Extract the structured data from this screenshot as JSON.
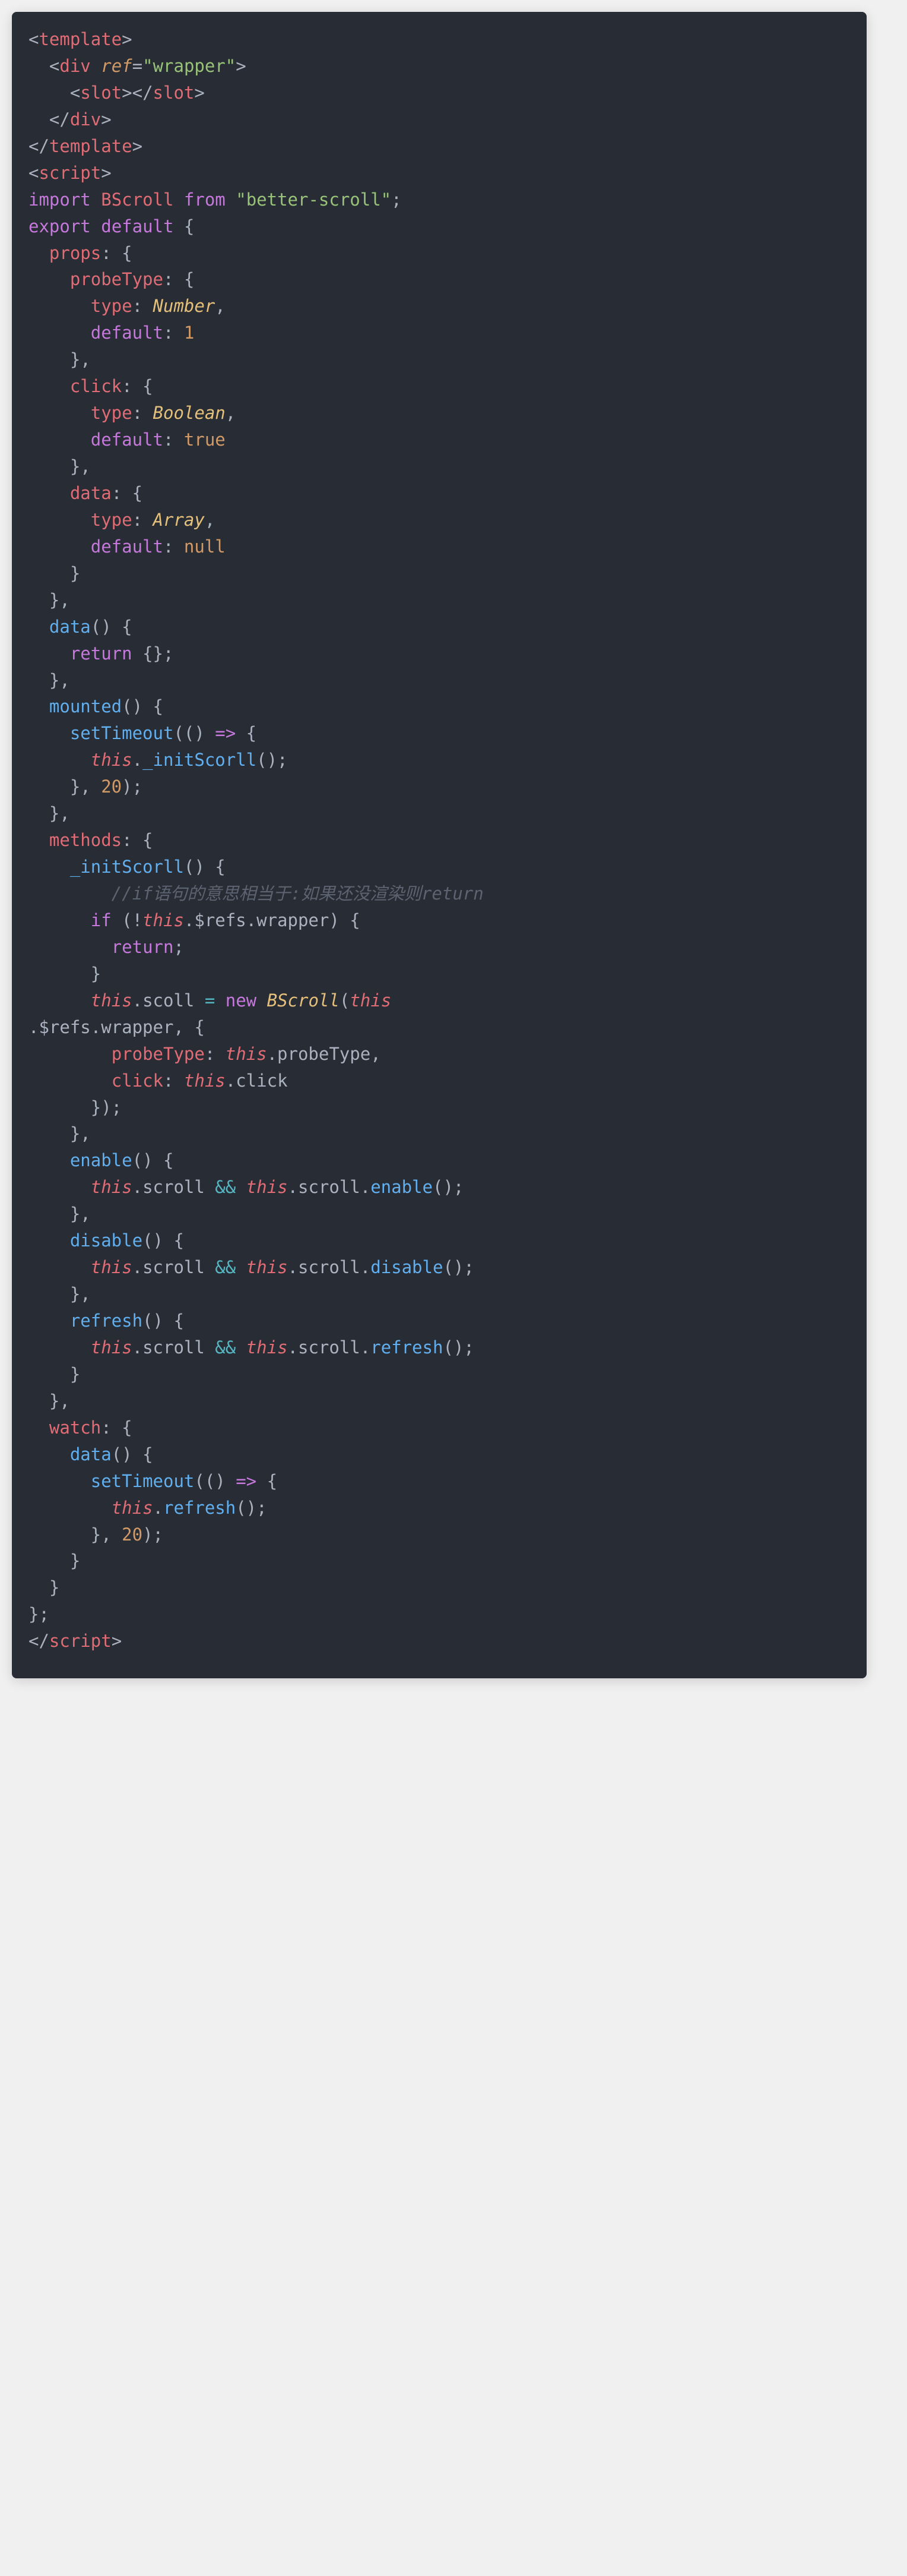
{
  "lines": [
    [
      {
        "c": "p",
        "t": "<"
      },
      {
        "c": "r",
        "t": "template"
      },
      {
        "c": "p",
        "t": ">"
      }
    ],
    [
      {
        "c": "p",
        "t": "  <"
      },
      {
        "c": "r",
        "t": "div"
      },
      {
        "c": "p",
        "t": " "
      },
      {
        "c": "o i",
        "t": "ref"
      },
      {
        "c": "p",
        "t": "="
      },
      {
        "c": "g",
        "t": "\"wrapper\""
      },
      {
        "c": "p",
        "t": ">"
      }
    ],
    [
      {
        "c": "p",
        "t": "    <"
      },
      {
        "c": "r",
        "t": "slot"
      },
      {
        "c": "p",
        "t": "></"
      },
      {
        "c": "r",
        "t": "slot"
      },
      {
        "c": "p",
        "t": ">"
      }
    ],
    [
      {
        "c": "p",
        "t": "  </"
      },
      {
        "c": "r",
        "t": "div"
      },
      {
        "c": "p",
        "t": ">"
      }
    ],
    [
      {
        "c": "p",
        "t": "</"
      },
      {
        "c": "r",
        "t": "template"
      },
      {
        "c": "p",
        "t": ">"
      }
    ],
    [
      {
        "c": "p",
        "t": "<"
      },
      {
        "c": "r",
        "t": "script"
      },
      {
        "c": "p",
        "t": ">"
      }
    ],
    [
      {
        "c": "pu",
        "t": "import"
      },
      {
        "c": "p",
        "t": " "
      },
      {
        "c": "r",
        "t": "BScroll"
      },
      {
        "c": "p",
        "t": " "
      },
      {
        "c": "pu",
        "t": "from"
      },
      {
        "c": "p",
        "t": " "
      },
      {
        "c": "g",
        "t": "\"better-scroll\""
      },
      {
        "c": "p",
        "t": ";"
      }
    ],
    [
      {
        "c": "pu",
        "t": "export"
      },
      {
        "c": "p",
        "t": " "
      },
      {
        "c": "pu",
        "t": "default"
      },
      {
        "c": "p",
        "t": " {"
      }
    ],
    [
      {
        "c": "p",
        "t": "  "
      },
      {
        "c": "r",
        "t": "props"
      },
      {
        "c": "p",
        "t": ": {"
      }
    ],
    [
      {
        "c": "p",
        "t": "    "
      },
      {
        "c": "r",
        "t": "probeType"
      },
      {
        "c": "p",
        "t": ": {"
      }
    ],
    [
      {
        "c": "p",
        "t": "      "
      },
      {
        "c": "r",
        "t": "type"
      },
      {
        "c": "p",
        "t": ": "
      },
      {
        "c": "y i",
        "t": "Number"
      },
      {
        "c": "p",
        "t": ","
      }
    ],
    [
      {
        "c": "p",
        "t": "      "
      },
      {
        "c": "pu",
        "t": "default"
      },
      {
        "c": "p",
        "t": ": "
      },
      {
        "c": "o",
        "t": "1"
      }
    ],
    [
      {
        "c": "p",
        "t": "    },"
      }
    ],
    [
      {
        "c": "p",
        "t": "    "
      },
      {
        "c": "r",
        "t": "click"
      },
      {
        "c": "p",
        "t": ": {"
      }
    ],
    [
      {
        "c": "p",
        "t": "      "
      },
      {
        "c": "r",
        "t": "type"
      },
      {
        "c": "p",
        "t": ": "
      },
      {
        "c": "y i",
        "t": "Boolean"
      },
      {
        "c": "p",
        "t": ","
      }
    ],
    [
      {
        "c": "p",
        "t": "      "
      },
      {
        "c": "pu",
        "t": "default"
      },
      {
        "c": "p",
        "t": ": "
      },
      {
        "c": "o",
        "t": "true"
      }
    ],
    [
      {
        "c": "p",
        "t": "    },"
      }
    ],
    [
      {
        "c": "p",
        "t": "    "
      },
      {
        "c": "r",
        "t": "data"
      },
      {
        "c": "p",
        "t": ": {"
      }
    ],
    [
      {
        "c": "p",
        "t": "      "
      },
      {
        "c": "r",
        "t": "type"
      },
      {
        "c": "p",
        "t": ": "
      },
      {
        "c": "y i",
        "t": "Array"
      },
      {
        "c": "p",
        "t": ","
      }
    ],
    [
      {
        "c": "p",
        "t": "      "
      },
      {
        "c": "pu",
        "t": "default"
      },
      {
        "c": "p",
        "t": ": "
      },
      {
        "c": "o",
        "t": "null"
      }
    ],
    [
      {
        "c": "p",
        "t": "    }"
      }
    ],
    [
      {
        "c": "p",
        "t": "  },"
      }
    ],
    [
      {
        "c": "p",
        "t": "  "
      },
      {
        "c": "b",
        "t": "data"
      },
      {
        "c": "p",
        "t": "() {"
      }
    ],
    [
      {
        "c": "p",
        "t": "    "
      },
      {
        "c": "pu",
        "t": "return"
      },
      {
        "c": "p",
        "t": " {};"
      }
    ],
    [
      {
        "c": "p",
        "t": "  },"
      }
    ],
    [
      {
        "c": "p",
        "t": "  "
      },
      {
        "c": "b",
        "t": "mounted"
      },
      {
        "c": "p",
        "t": "() {"
      }
    ],
    [
      {
        "c": "p",
        "t": "    "
      },
      {
        "c": "b",
        "t": "setTimeout"
      },
      {
        "c": "p",
        "t": "(() "
      },
      {
        "c": "pu",
        "t": "=>"
      },
      {
        "c": "p",
        "t": " {"
      }
    ],
    [
      {
        "c": "p",
        "t": "      "
      },
      {
        "c": "r i",
        "t": "this"
      },
      {
        "c": "p",
        "t": "."
      },
      {
        "c": "b",
        "t": "_initScorll"
      },
      {
        "c": "p",
        "t": "();"
      }
    ],
    [
      {
        "c": "p",
        "t": "    }, "
      },
      {
        "c": "o",
        "t": "20"
      },
      {
        "c": "p",
        "t": ");"
      }
    ],
    [
      {
        "c": "p",
        "t": "  },"
      }
    ],
    [
      {
        "c": "p",
        "t": "  "
      },
      {
        "c": "r",
        "t": "methods"
      },
      {
        "c": "p",
        "t": ": {"
      }
    ],
    [
      {
        "c": "p",
        "t": "    "
      },
      {
        "c": "b",
        "t": "_initScorll"
      },
      {
        "c": "p",
        "t": "() {"
      }
    ],
    [
      {
        "c": "gr",
        "t": "        //if语句的意思相当于:如果还没渲染则return"
      }
    ],
    [
      {
        "c": "p",
        "t": "      "
      },
      {
        "c": "pu",
        "t": "if"
      },
      {
        "c": "p",
        "t": " (!"
      },
      {
        "c": "r i",
        "t": "this"
      },
      {
        "c": "p",
        "t": ".$refs.wrapper) {"
      }
    ],
    [
      {
        "c": "p",
        "t": "        "
      },
      {
        "c": "pu",
        "t": "return"
      },
      {
        "c": "p",
        "t": ";"
      }
    ],
    [
      {
        "c": "p",
        "t": "      }"
      }
    ],
    [
      {
        "c": "p",
        "t": "      "
      },
      {
        "c": "r i",
        "t": "this"
      },
      {
        "c": "p",
        "t": ".scoll "
      },
      {
        "c": "c",
        "t": "="
      },
      {
        "c": "p",
        "t": " "
      },
      {
        "c": "pu",
        "t": "new"
      },
      {
        "c": "p",
        "t": " "
      },
      {
        "c": "y i",
        "t": "BScroll"
      },
      {
        "c": "p",
        "t": "("
      },
      {
        "c": "r i",
        "t": "this"
      }
    ],
    [
      {
        "c": "p",
        "t": ".$refs.wrapper, {"
      }
    ],
    [
      {
        "c": "p",
        "t": "        "
      },
      {
        "c": "r",
        "t": "probeType"
      },
      {
        "c": "p",
        "t": ": "
      },
      {
        "c": "r i",
        "t": "this"
      },
      {
        "c": "p",
        "t": ".probeType,"
      }
    ],
    [
      {
        "c": "p",
        "t": "        "
      },
      {
        "c": "r",
        "t": "click"
      },
      {
        "c": "p",
        "t": ": "
      },
      {
        "c": "r i",
        "t": "this"
      },
      {
        "c": "p",
        "t": ".click"
      }
    ],
    [
      {
        "c": "p",
        "t": "      });"
      }
    ],
    [
      {
        "c": "p",
        "t": "    },"
      }
    ],
    [
      {
        "c": "p",
        "t": "    "
      },
      {
        "c": "b",
        "t": "enable"
      },
      {
        "c": "p",
        "t": "() {"
      }
    ],
    [
      {
        "c": "p",
        "t": "      "
      },
      {
        "c": "r i",
        "t": "this"
      },
      {
        "c": "p",
        "t": ".scroll "
      },
      {
        "c": "c",
        "t": "&&"
      },
      {
        "c": "p",
        "t": " "
      },
      {
        "c": "r i",
        "t": "this"
      },
      {
        "c": "p",
        "t": ".scroll."
      },
      {
        "c": "b",
        "t": "enable"
      },
      {
        "c": "p",
        "t": "();"
      }
    ],
    [
      {
        "c": "p",
        "t": "    },"
      }
    ],
    [
      {
        "c": "p",
        "t": "    "
      },
      {
        "c": "b",
        "t": "disable"
      },
      {
        "c": "p",
        "t": "() {"
      }
    ],
    [
      {
        "c": "p",
        "t": "      "
      },
      {
        "c": "r i",
        "t": "this"
      },
      {
        "c": "p",
        "t": ".scroll "
      },
      {
        "c": "c",
        "t": "&&"
      },
      {
        "c": "p",
        "t": " "
      },
      {
        "c": "r i",
        "t": "this"
      },
      {
        "c": "p",
        "t": ".scroll."
      },
      {
        "c": "b",
        "t": "disable"
      },
      {
        "c": "p",
        "t": "();"
      }
    ],
    [
      {
        "c": "p",
        "t": "    },"
      }
    ],
    [
      {
        "c": "p",
        "t": "    "
      },
      {
        "c": "b",
        "t": "refresh"
      },
      {
        "c": "p",
        "t": "() {"
      }
    ],
    [
      {
        "c": "p",
        "t": "      "
      },
      {
        "c": "r i",
        "t": "this"
      },
      {
        "c": "p",
        "t": ".scroll "
      },
      {
        "c": "c",
        "t": "&&"
      },
      {
        "c": "p",
        "t": " "
      },
      {
        "c": "r i",
        "t": "this"
      },
      {
        "c": "p",
        "t": ".scroll."
      },
      {
        "c": "b",
        "t": "refresh"
      },
      {
        "c": "p",
        "t": "();"
      }
    ],
    [
      {
        "c": "p",
        "t": "    }"
      }
    ],
    [
      {
        "c": "p",
        "t": "  },"
      }
    ],
    [
      {
        "c": "p",
        "t": "  "
      },
      {
        "c": "r",
        "t": "watch"
      },
      {
        "c": "p",
        "t": ": {"
      }
    ],
    [
      {
        "c": "p",
        "t": "    "
      },
      {
        "c": "b",
        "t": "data"
      },
      {
        "c": "p",
        "t": "() {"
      }
    ],
    [
      {
        "c": "p",
        "t": "      "
      },
      {
        "c": "b",
        "t": "setTimeout"
      },
      {
        "c": "p",
        "t": "(() "
      },
      {
        "c": "pu",
        "t": "=>"
      },
      {
        "c": "p",
        "t": " {"
      }
    ],
    [
      {
        "c": "p",
        "t": "        "
      },
      {
        "c": "r i",
        "t": "this"
      },
      {
        "c": "p",
        "t": "."
      },
      {
        "c": "b",
        "t": "refresh"
      },
      {
        "c": "p",
        "t": "();"
      }
    ],
    [
      {
        "c": "p",
        "t": "      }, "
      },
      {
        "c": "o",
        "t": "20"
      },
      {
        "c": "p",
        "t": ");"
      }
    ],
    [
      {
        "c": "p",
        "t": "    }"
      }
    ],
    [
      {
        "c": "p",
        "t": "  }"
      }
    ],
    [
      {
        "c": "p",
        "t": "};"
      }
    ],
    [
      {
        "c": "p",
        "t": "</"
      },
      {
        "c": "r",
        "t": "script"
      },
      {
        "c": "p",
        "t": ">"
      }
    ]
  ]
}
